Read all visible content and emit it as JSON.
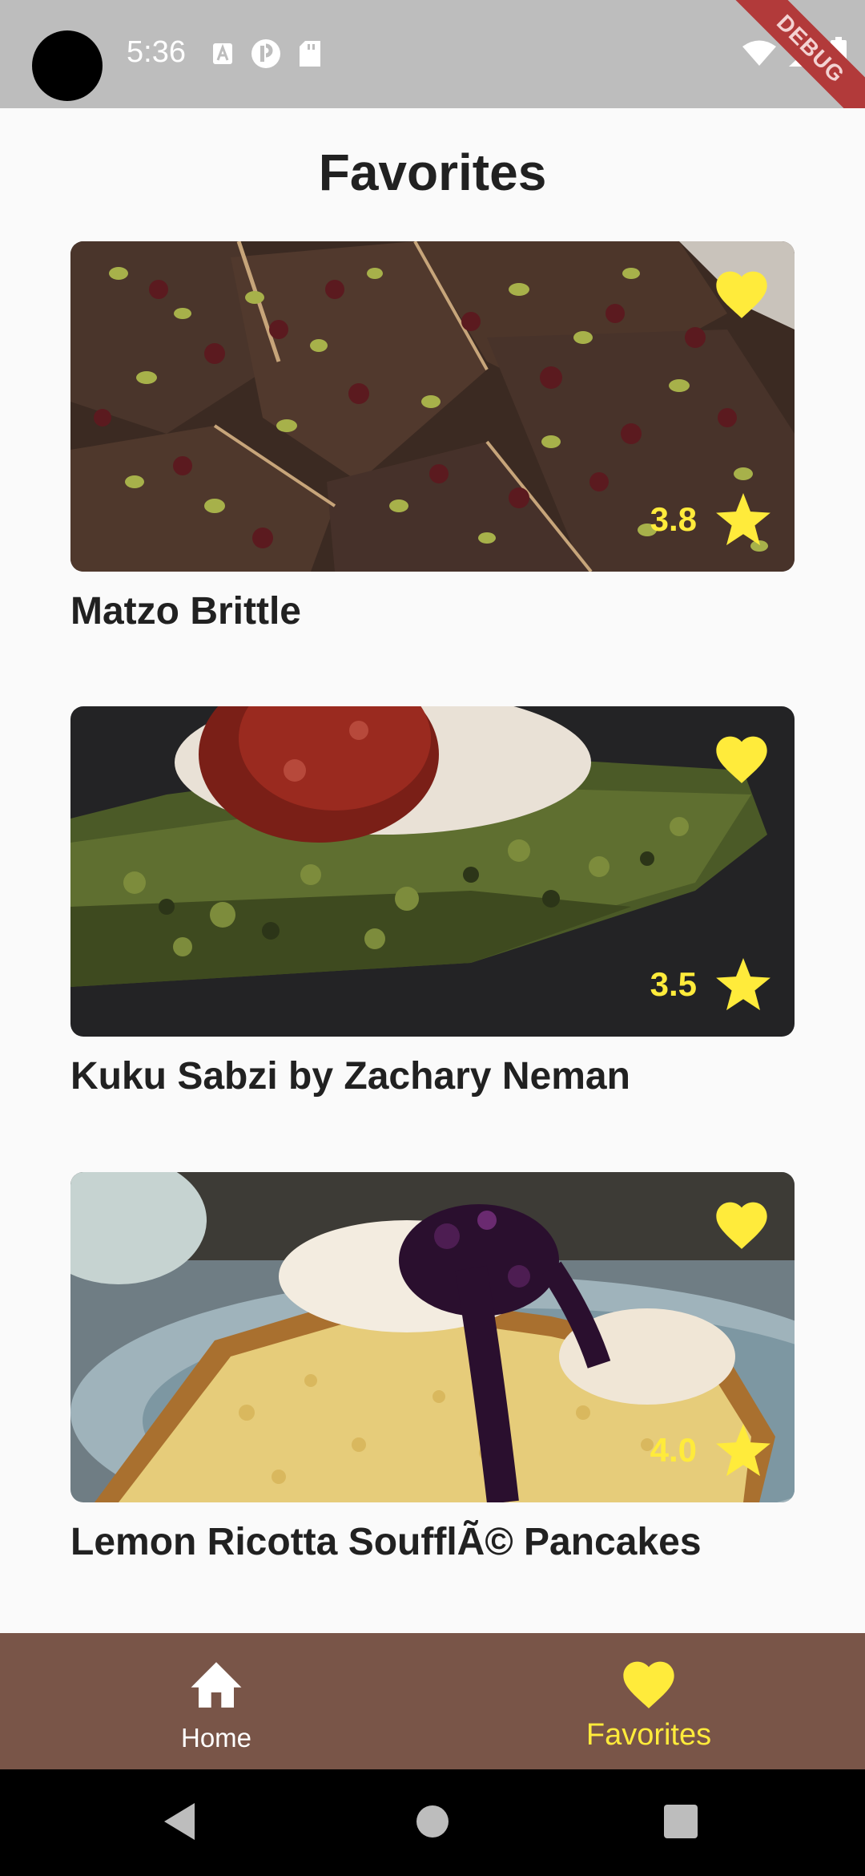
{
  "status_bar": {
    "time": "5:36",
    "debug_banner": "DEBUG",
    "left_icons": [
      "font-icon",
      "podcast-icon",
      "sd-card-icon"
    ],
    "right_icons": [
      "wifi-icon",
      "signal-icon",
      "battery-icon"
    ]
  },
  "page": {
    "title": "Favorites"
  },
  "recipes": [
    {
      "title": "Matzo Brittle",
      "rating": "3.8",
      "favorite": true,
      "image": "matzo-brittle-photo"
    },
    {
      "title": "Kuku Sabzi by Zachary Neman",
      "rating": "3.5",
      "favorite": true,
      "image": "kuku-sabzi-photo"
    },
    {
      "title": "Lemon Ricotta SoufflÃ© Pancakes",
      "rating": "4.0",
      "favorite": true,
      "image": "ricotta-pancakes-photo"
    }
  ],
  "bottom_nav": {
    "items": [
      {
        "label": "Home",
        "icon": "home-icon",
        "active": false
      },
      {
        "label": "Favorites",
        "icon": "heart-icon",
        "active": true
      }
    ]
  },
  "colors": {
    "accent": "#ffeb3b",
    "nav_background": "#795548",
    "status_bar": "#bdbdbd",
    "title_text": "#212121"
  }
}
